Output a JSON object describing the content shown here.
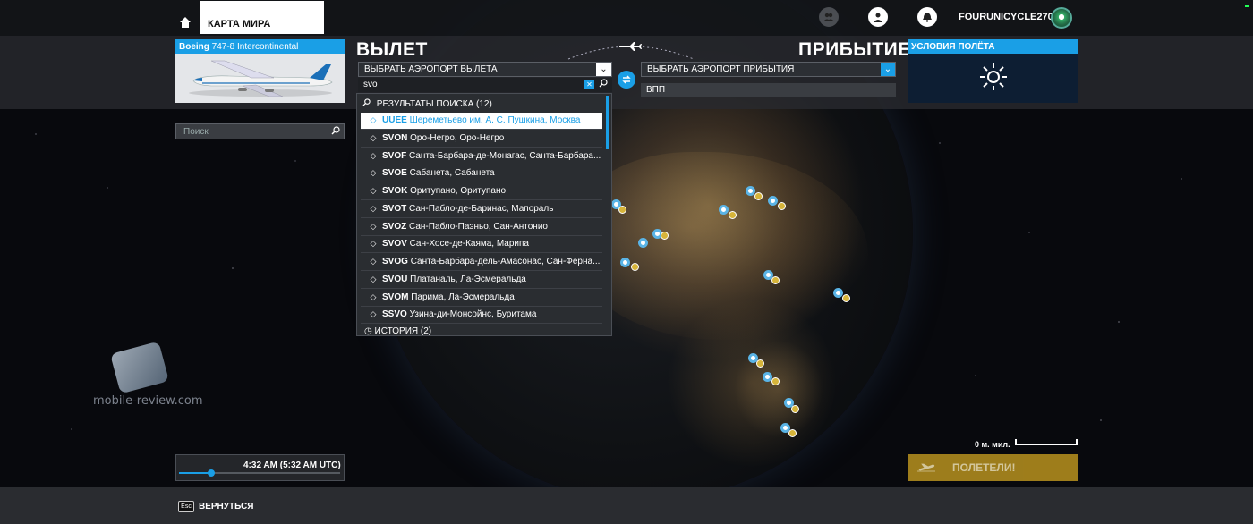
{
  "topbar": {
    "tab_label": "КАРТА МИРА",
    "username": "FOURUNICYCLE270",
    "icons": [
      "home-icon",
      "friends-icon",
      "profile-icon",
      "notifications-icon",
      "avatar"
    ]
  },
  "aircraft": {
    "brand": "Boeing",
    "model": " 747-8 Intercontinental"
  },
  "departure": {
    "title": "ВЫЛЕТ",
    "select_label": "ВЫБРАТЬ АЭРОПОРТ ВЫЛЕТА",
    "search_value": "svo"
  },
  "arrival": {
    "title": "ПРИБЫТИЕ",
    "select_label": "ВЫБРАТЬ АЭРОПОРТ ПРИБЫТИЯ",
    "runway_label": "ВПП"
  },
  "conditions": {
    "title": "УСЛОВИЯ ПОЛЁТА",
    "weather_icon": "sun-icon"
  },
  "map_search": {
    "placeholder": "Поиск"
  },
  "results": {
    "header": "РЕЗУЛЬТАТЫ ПОИСКА (12)",
    "items": [
      {
        "code": "UUEE",
        "name": "Шереметьево им. А. С. Пушкина, Москва"
      },
      {
        "code": "SVON",
        "name": "Оро-Негро, Оро-Негро"
      },
      {
        "code": "SVOF",
        "name": "Санта-Барбара-де-Монагас, Санта-Барбара..."
      },
      {
        "code": "SVOE",
        "name": "Сабанета, Сабанета"
      },
      {
        "code": "SVOK",
        "name": "Оритупано, Оритупано"
      },
      {
        "code": "SVOT",
        "name": "Сан-Пабло-де-Баринас, Мапораль"
      },
      {
        "code": "SVOZ",
        "name": "Сан-Пабло-Паэньо, Сан-Антонио"
      },
      {
        "code": "SVOV",
        "name": "Сан-Хосе-де-Каяма, Марипа"
      },
      {
        "code": "SVOG",
        "name": "Санта-Барбара-дель-Амасонас, Сан-Ферна..."
      },
      {
        "code": "SVOU",
        "name": "Платаналь, Ла-Эсмеральда"
      },
      {
        "code": "SVOM",
        "name": "Парима, Ла-Эсмеральда"
      },
      {
        "code": "SSVO",
        "name": "Узина-ди-Монсойнс, Буритама"
      }
    ],
    "selected_index": 0,
    "history_label": "ИСТОРИЯ (2)"
  },
  "time": {
    "label": "4:32 AM (5:32 AM UTC)",
    "slider_fraction": 0.2
  },
  "scale": {
    "label": "0 м. мил."
  },
  "fly_button": {
    "label": "ПОЛЕТЕЛИ!"
  },
  "bottombar": {
    "esc_key": "Esc",
    "back_label": "ВЕРНУТЬСЯ"
  },
  "watermark": {
    "text": "mobile-review.com"
  },
  "colors": {
    "accent": "#1a9fe6",
    "fly_button": "#b8921f"
  }
}
